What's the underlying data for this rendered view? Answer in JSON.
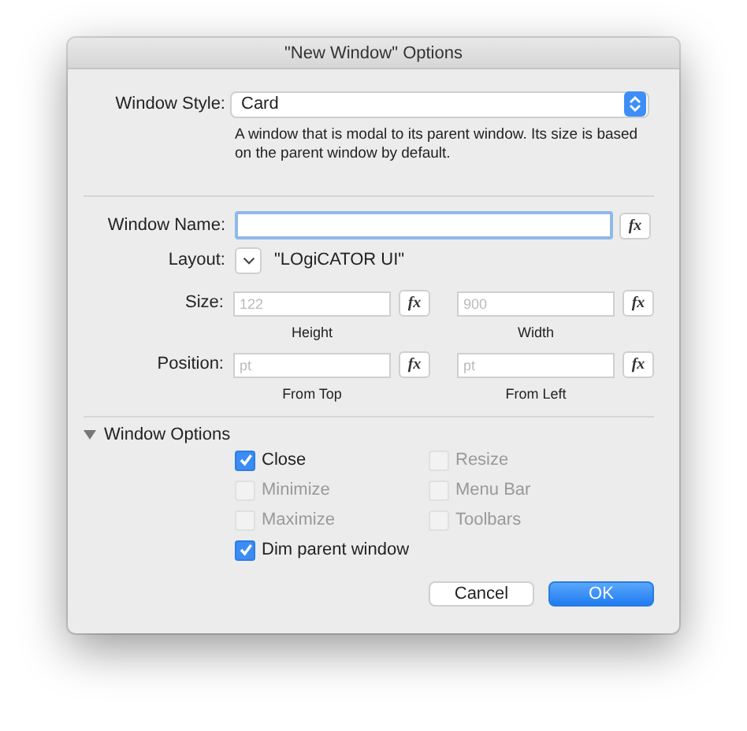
{
  "window": {
    "title": "\"New Window\" Options"
  },
  "window_style": {
    "label": "Window Style:",
    "value": "Card",
    "description": "A window that is modal to its parent window. Its size is based on the parent window by default."
  },
  "window_name": {
    "label": "Window Name:",
    "fx": "fx"
  },
  "layout": {
    "label": "Layout:",
    "value": "\"LOgiCATOR UI\""
  },
  "size": {
    "label": "Size:",
    "fields": [
      {
        "placeholder": "122",
        "caption": "Height",
        "fx": "fx"
      },
      {
        "placeholder": "900",
        "caption": "Width",
        "fx": "fx"
      }
    ]
  },
  "position": {
    "label": "Position:",
    "fields": [
      {
        "placeholder": "pt",
        "caption": "From Top",
        "fx": "fx"
      },
      {
        "placeholder": "pt",
        "caption": "From Left",
        "fx": "fx"
      }
    ]
  },
  "window_options": {
    "label": "Window Options",
    "expanded": true,
    "options": [
      {
        "label": "Close",
        "checked": true,
        "disabled": false
      },
      {
        "label": "Resize",
        "checked": false,
        "disabled": true
      },
      {
        "label": "Minimize",
        "checked": false,
        "disabled": true
      },
      {
        "label": "Menu Bar",
        "checked": false,
        "disabled": true
      },
      {
        "label": "Maximize",
        "checked": false,
        "disabled": true
      },
      {
        "label": "Toolbars",
        "checked": false,
        "disabled": true
      },
      {
        "label": "Dim parent window",
        "checked": true,
        "disabled": false
      }
    ]
  },
  "buttons": [
    "Cancel",
    "OK"
  ]
}
